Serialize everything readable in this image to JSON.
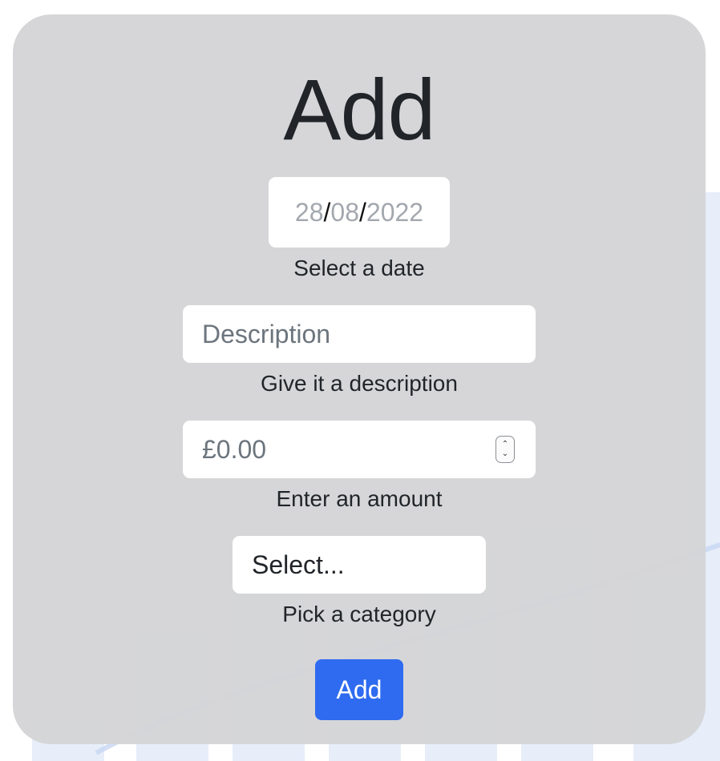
{
  "form": {
    "title": "Add",
    "date": {
      "day": "28",
      "month": "08",
      "year": "2022",
      "separator": "/"
    },
    "date_help": "Select a date",
    "description": {
      "placeholder": "Description"
    },
    "description_help": "Give it a description",
    "amount": {
      "placeholder": "£0.00"
    },
    "amount_help": "Enter an amount",
    "category": {
      "selected": "Select..."
    },
    "category_help": "Pick a category",
    "submit_label": "Add"
  },
  "icons": {
    "spin_up": "chevron-up-icon",
    "spin_down": "chevron-down-icon"
  },
  "colors": {
    "accent": "#2f6bf0",
    "card_bg": "#d4d4d6"
  }
}
